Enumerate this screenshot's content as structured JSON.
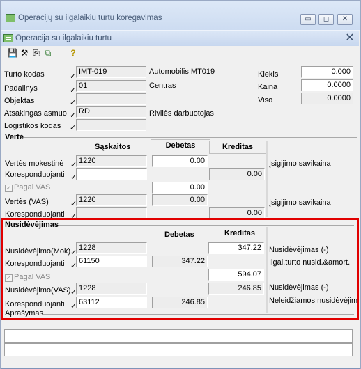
{
  "bg_window": {
    "title": "Operacijų su ilgalaikiu turtu koregavimas",
    "controls": [
      "▭",
      "◻",
      "✕"
    ]
  },
  "window": {
    "title": "Operacija su ilgalaikiu turtu",
    "close": "✕"
  },
  "toolbar": {
    "save": "💾",
    "tools": [
      "⚒",
      "⎘",
      "⧉"
    ],
    "help": "?"
  },
  "header": {
    "turto_kodas": {
      "label": "Turto kodas",
      "value": "IMT-019",
      "desc": "Automobilis MT019"
    },
    "padalinys": {
      "label": "Padalinys",
      "value": "01",
      "desc": "Centras"
    },
    "objektas": {
      "label": "Objektas",
      "value": ""
    },
    "atsakingas": {
      "label": "Atsakingas asmuo",
      "value": "RD",
      "desc": "Rivilės darbuotojas"
    },
    "logistikos": {
      "label": "Logistikos kodas",
      "value": ""
    },
    "kiekis": {
      "label": "Kiekis",
      "value": "0.000"
    },
    "kaina": {
      "label": "Kaina",
      "value": "0.0000"
    },
    "viso": {
      "label": "Viso",
      "value": "0.0000"
    }
  },
  "verte": {
    "title": "Vertė",
    "col_saskaitos": "Sąskaitos",
    "col_debetas": "Debetas",
    "col_kreditas": "Kreditas",
    "row1": {
      "label": "Vertės mokestinė",
      "account": "1220",
      "debetas": "0.00",
      "note": "Įsigijimo savikaina"
    },
    "row2": {
      "label": "Koresponduojanti",
      "account": "",
      "kreditas": "0.00"
    },
    "pagal_vas": {
      "label": "Pagal VAS",
      "value": "0.00"
    },
    "row3": {
      "label": "Vertės (VAS)",
      "account": "1220",
      "debetas": "0.00",
      "note": "Įsigijimo savikaina"
    },
    "row4": {
      "label": "Koresponduojanti",
      "account": "",
      "kreditas": "0.00"
    }
  },
  "nusidevejimas": {
    "title": "Nusidėvėjimas",
    "col_debetas": "Debetas",
    "col_kreditas": "Kreditas",
    "row1": {
      "label": "Nusidėvėjimo(Mok)",
      "account": "1228",
      "kreditas": "347.22",
      "note": "Nusidėvėjimas (-)"
    },
    "row2": {
      "label": "Koresponduojanti",
      "account": "61150",
      "debetas": "347.22",
      "note": "Ilgal.turto nusid.&amort."
    },
    "pagal_vas": {
      "label": "Pagal VAS",
      "value": "594.07"
    },
    "row3": {
      "label": "Nusidėvėjimo(VAS)",
      "account": "1228",
      "kreditas": "246.85",
      "note": "Nusidėvėjimas (-)"
    },
    "row4": {
      "label": "Koresponduojanti",
      "account": "63112",
      "debetas": "246.85",
      "note": "Neleidžiamos nusidėvėjim"
    }
  },
  "aprasymas": {
    "label": "Aprašymas"
  },
  "colors": {
    "highlight": "#e10000"
  }
}
